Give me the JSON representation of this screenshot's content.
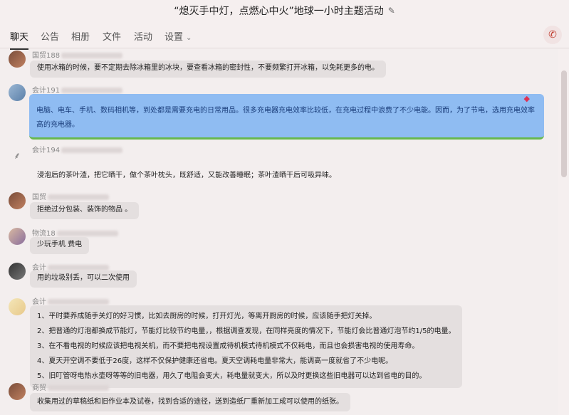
{
  "window": {
    "title": "“熄灭手中灯，点燃心中火”地球一小时主题活动",
    "edit_icon": "✎"
  },
  "tabs": [
    {
      "label": "聊天",
      "active": true
    },
    {
      "label": "公告",
      "active": false
    },
    {
      "label": "相册",
      "active": false
    },
    {
      "label": "文件",
      "active": false
    },
    {
      "label": "活动",
      "active": false
    },
    {
      "label": "设置",
      "active": false
    }
  ],
  "call_icon": "phone-icon",
  "messages": [
    {
      "sender": "国贸188",
      "text": "使用冰箱的时候，要不定期去除冰箱里的冰块，要查看冰箱的密封性，不要频繁打开冰箱，以免耗更多的电。"
    },
    {
      "sender": "会计191",
      "text": "电脑、电车、手机、数码相机等，到处都是需要充电的日常用品。很多充电器充电效率比较低，在充电过程中浪费了不少电能。因而，为了节电，选用充电效率高的充电器。"
    },
    {
      "sender": "会计194",
      "text": "浸泡后的茶叶渣，把它晒干，做个茶叶枕头，既舒适，又能改善睡眠；茶叶渣晒干后可吸异味。"
    },
    {
      "sender": "国贸",
      "text": "拒绝过分包装、装饰的物品 。"
    },
    {
      "sender": "物流18",
      "text": "少玩手机  费电"
    },
    {
      "sender": "会计",
      "text": "用的垃圾别丢，可以二次使用"
    },
    {
      "sender": "会计",
      "lines": [
        "1、平时要养成随手关灯的好习惯，比如去厨房的时候，打开灯光，等离开厨房的时候，应该随手把灯关掉。",
        "2、把普通的灯泡都换成节能灯，节能灯比较节约电量，，根据调查发现，在同样亮度的情况下，节能灯会比普通灯泡节约1/5的电量。",
        "3、在不看电视的时候应该把电视关机，而不要把电视设置成待机模式待机模式不仅耗电，而且也会损害电视的使用寿命。",
        "4、夏天开空调不要低于26度，这样不仅保护健康还省电。夏天空调耗电量非常大，能调高一度就省了不少电呢。",
        "5、旧叮管呀电热水壶呀等等的旧电器，用久了电阻会变大，耗电量就变大，所以及时更换这些旧电器可以达到省电的目的。"
      ]
    },
    {
      "sender": "商贸",
      "text": "收集用过的草稿纸和旧作业本及试卷，找到合适的途径，送到造纸厂重新加工成可以使用的纸张。"
    }
  ]
}
